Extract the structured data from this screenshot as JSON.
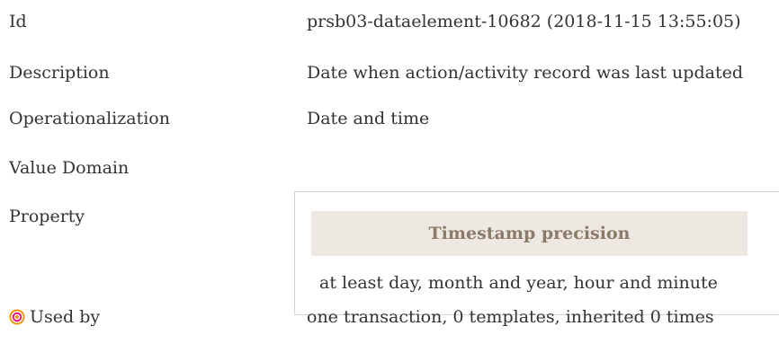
{
  "rows": {
    "id": {
      "label": "Id",
      "value": "prsb03-dataelement-10682 (2018-11-15 13:55:05)"
    },
    "description": {
      "label": "Description",
      "value": "Date when action/activity record was last updated"
    },
    "operationalization": {
      "label": "Operationalization",
      "value": "Date and time"
    },
    "value_domain": {
      "label": "Value Domain"
    },
    "property": {
      "label": "Property",
      "header": "Timestamp precision",
      "text": "at least day, month and year, hour and minute"
    },
    "used_by": {
      "label": "Used by",
      "icon": "target-icon",
      "value": "one transaction, 0 templates, inherited 0 times"
    }
  },
  "colors": {
    "text": "#333333",
    "header_bg": "#ede8e2",
    "header_text": "#8b7a68",
    "box_border": "#d8d2ca",
    "icon_orange": "#f29100",
    "icon_magenta": "#e0007a"
  }
}
